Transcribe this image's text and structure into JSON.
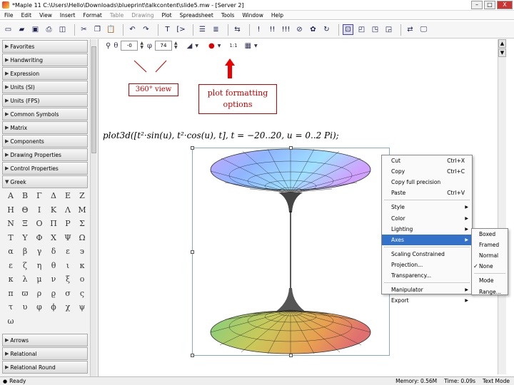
{
  "window": {
    "title": "*Maple 11  C:\\Users\\Hello\\Downloads\\blueprint\\talkcontent\\slide5.mw - [Server 2]",
    "minimize": "–",
    "maximize": "□",
    "close": "X"
  },
  "menu": [
    "File",
    "Edit",
    "View",
    "Insert",
    "Format",
    "Table",
    "Drawing",
    "Plot",
    "Spreadsheet",
    "Tools",
    "Window",
    "Help"
  ],
  "palettes": {
    "headers_top": [
      "Favorites",
      "Handwriting",
      "Expression",
      "Units (SI)",
      "Units (FPS)",
      "Common Symbols",
      "Matrix",
      "Components",
      "Drawing Properties",
      "Control Properties",
      "Greek"
    ],
    "greek_symbols": [
      "Α",
      "Β",
      "Γ",
      "Δ",
      "Ε",
      "Ζ",
      "Η",
      "Θ",
      "Ι",
      "Κ",
      "Λ",
      "Μ",
      "Ν",
      "Ξ",
      "Ο",
      "Π",
      "Ρ",
      "Σ",
      "Τ",
      "Υ",
      "Φ",
      "Χ",
      "Ψ",
      "Ω",
      "α",
      "β",
      "γ",
      "δ",
      "ε",
      "϶",
      "ε",
      "ζ",
      "η",
      "θ",
      "ι",
      "κ",
      "κ",
      "λ",
      "μ",
      "ν",
      "ξ",
      "ο",
      "π",
      "ϖ",
      "ρ",
      "ϱ",
      "σ",
      "ς",
      "τ",
      "υ",
      "φ",
      "ϕ",
      "χ",
      "ψ",
      "ω"
    ],
    "headers_bottom": [
      "Arrows",
      "Relational",
      "Relational Round"
    ]
  },
  "plot_toolbar": {
    "theta": "-0",
    "phi": "74",
    "sample": "1:1"
  },
  "annotations": {
    "view": "360° view",
    "format_line1": "plot formatting",
    "format_line2": "options"
  },
  "command": "plot3d([t²·sin(u), t²·cos(u), t], t = −20..20, u = 0..2 Pi);",
  "context_menu": [
    {
      "label": "Cut",
      "shortcut": "Ctrl+X"
    },
    {
      "label": "Copy",
      "shortcut": "Ctrl+C"
    },
    {
      "label": "Copy full precision",
      "shortcut": ""
    },
    {
      "label": "Paste",
      "shortcut": "Ctrl+V"
    },
    {
      "label": "Style",
      "submenu": true
    },
    {
      "label": "Color",
      "submenu": true
    },
    {
      "label": "Lighting",
      "submenu": true
    },
    {
      "label": "Axes",
      "submenu": true,
      "highlighted": true
    },
    {
      "label": "Scaling Constrained"
    },
    {
      "label": "Projection..."
    },
    {
      "label": "Transparency..."
    },
    {
      "label": "Manipulator",
      "submenu": true
    },
    {
      "label": "Export",
      "submenu": true
    }
  ],
  "axes_submenu": [
    {
      "label": "Boxed",
      "checked": false
    },
    {
      "label": "Framed",
      "checked": false
    },
    {
      "label": "Normal",
      "checked": false
    },
    {
      "label": "None",
      "checked": true
    },
    {
      "label": "Mode",
      "checked": false
    },
    {
      "label": "Range...",
      "checked": false
    }
  ],
  "status": {
    "left": "Ready",
    "memory": "Memory: 0.56M",
    "time": "Time: 0.09s",
    "mode": "Text Mode"
  },
  "colors": {
    "annotation": "#cc0000",
    "highlight": "#3372c8"
  }
}
